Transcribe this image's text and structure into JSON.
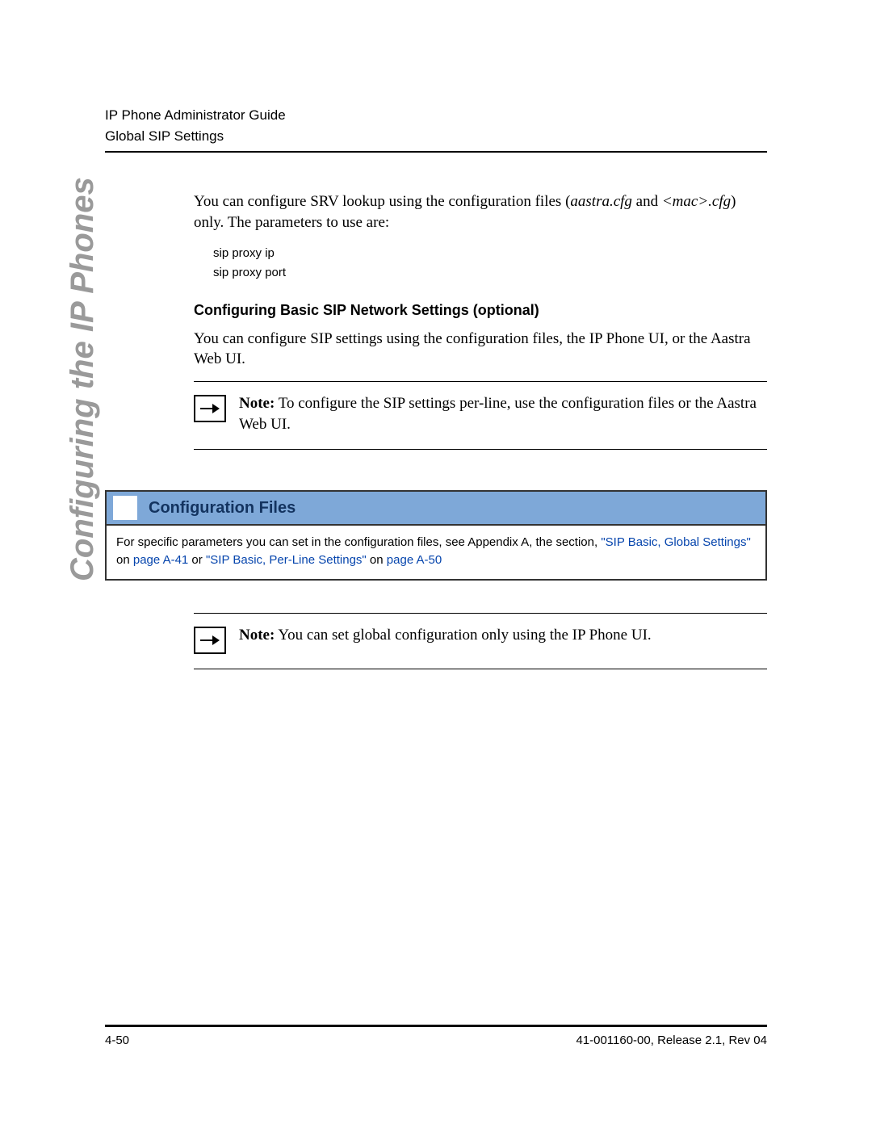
{
  "header": {
    "line1": "IP Phone Administrator Guide",
    "line2": "Global SIP Settings"
  },
  "sidebar_title": "Configuring the IP Phones",
  "intro": {
    "part1": "You can configure SRV lookup using the configuration files (",
    "file1": "aastra.cfg",
    "part2": " and ",
    "file2": "<mac>.cfg",
    "part3": ") only. The parameters to use are:"
  },
  "params": {
    "p1": "sip proxy ip",
    "p2": "sip proxy port"
  },
  "subheading": "Configuring Basic SIP Network Settings (optional)",
  "subtext": "You can configure SIP settings using the configuration files, the IP Phone UI, or the Aastra Web UI.",
  "note1": {
    "label": "Note:",
    "text": " To configure the SIP settings per-line, use the configuration files or the Aastra Web UI."
  },
  "config": {
    "banner_title": "Configuration Files",
    "body_pre": "For specific parameters you can set in the configuration files, see Appendix A, the section, ",
    "link1": "\"SIP Basic, Global Settings\"",
    "mid1": " on ",
    "pageA": "page A-41",
    "mid2": " or ",
    "link2": "\"SIP Basic, Per-Line Settings\"",
    "mid3": " on ",
    "pageB": "page A-50"
  },
  "note2": {
    "label": "Note:",
    "text": " You can set global configuration only using the IP Phone UI."
  },
  "footer": {
    "left": "4-50",
    "right": "41-001160-00, Release 2.1, Rev 04"
  }
}
